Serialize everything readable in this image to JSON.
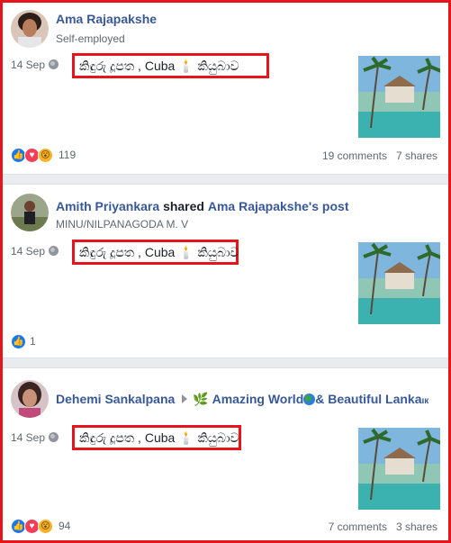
{
  "posts": [
    {
      "author": "Ama Rajapakshe",
      "subtitle": "Self-employed",
      "date": "14 Sep",
      "message": "කිඳුරු දූපත , Cuba 🕯️ කියුබාව",
      "reaction_count": "119",
      "comments": "19 comments",
      "shares": "7 shares"
    },
    {
      "author": "Amith Priyankara",
      "action": "shared",
      "shared_from": "Ama Rajapakshe's post",
      "subtitle": "MINU/NILPANAGODA M. V",
      "date": "14 Sep",
      "message": "කිඳුරු දූපත , Cuba 🕯️ කියුබාව",
      "reaction_count": "1"
    },
    {
      "author": "Dehemi Sankalpana",
      "group_prefix": "🌿",
      "group_name": "Amazing World",
      "group_suffix": "& Beautiful Lanka",
      "group_trunc": "ιк",
      "date": "14 Sep",
      "message": "කිඳුරු දූපත , Cuba 🕯️ කියුබාව",
      "reaction_count": "94",
      "comments": "7 comments",
      "shares": "3 shares"
    }
  ],
  "colors": {
    "highlight": "#e8141b",
    "link": "#385898",
    "like": "#1877f2",
    "love": "#f33e58",
    "wow": "#f7b125"
  }
}
